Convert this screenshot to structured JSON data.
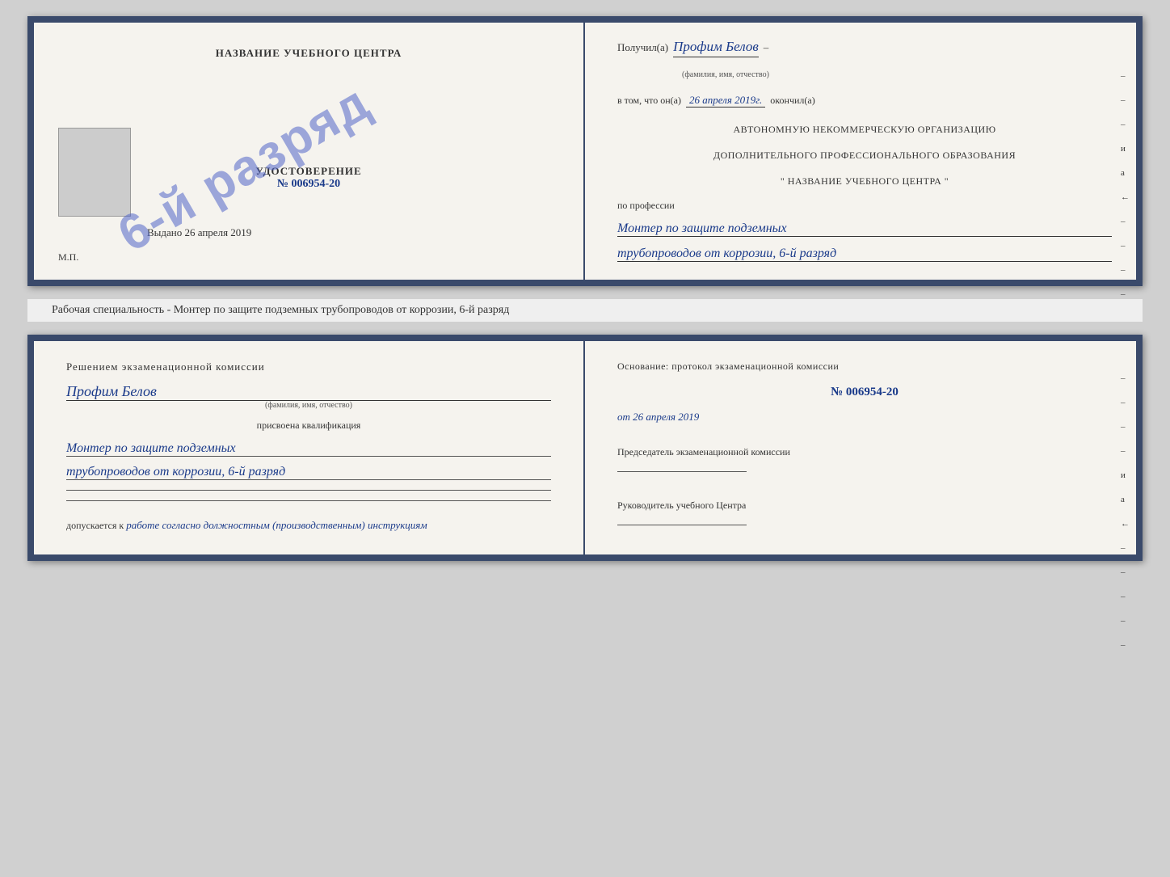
{
  "top_cert": {
    "left": {
      "title": "НАЗВАНИЕ УЧЕБНОГО ЦЕНТРА",
      "stamp_text": "6-й разряд",
      "udost_label": "УДОСТОВЕРЕНИЕ",
      "udost_number": "№ 006954-20",
      "vydano_label": "Выдано",
      "vydano_date": "26 апреля 2019",
      "mp_label": "М.П."
    },
    "right": {
      "recv_prefix": "Получил(а)",
      "recv_name": "Профим Белов",
      "recv_hint": "(фамилия, имя, отчество)",
      "vtom_prefix": "в том, что он(а)",
      "vtom_date": "26 апреля 2019г.",
      "vtom_suffix": "окончил(а)",
      "org_line1": "АВТОНОМНУЮ НЕКОММЕРЧЕСКУЮ ОРГАНИЗАЦИЮ",
      "org_line2": "ДОПОЛНИТЕЛЬНОГО ПРОФЕССИОНАЛЬНОГО ОБРАЗОВАНИЯ",
      "org_line3": "\"   НАЗВАНИЕ УЧЕБНОГО ЦЕНТРА   \"",
      "profession_label": "по профессии",
      "profession_line1": "Монтер по защите подземных",
      "profession_line2": "трубопроводов от коррозии, 6-й разряд",
      "sidebar_marks": [
        "–",
        "–",
        "–",
        "и",
        "а",
        "←",
        "–",
        "–",
        "–",
        "–"
      ]
    }
  },
  "middle_text": "Рабочая специальность - Монтер по защите подземных трубопроводов от коррозии, 6-й разряд",
  "bottom_cert": {
    "left": {
      "decision_title": "Решением экзаменационной комиссии",
      "person_name": "Профим Белов",
      "person_name_hint": "(фамилия, имя, отчество)",
      "prisvoena_text": "присвоена квалификация",
      "profession_line1": "Монтер по защите подземных",
      "profession_line2": "трубопроводов от коррозии, 6-й разряд",
      "dopusk_prefix": "допускается к",
      "dopusk_handwrite": "работе согласно должностным (производственным) инструкциям"
    },
    "right": {
      "osnov_text": "Основание: протокол экзаменационной комиссии",
      "protocol_number": "№  006954-20",
      "protocol_date_prefix": "от",
      "protocol_date": "26 апреля 2019",
      "chairman_title": "Председатель экзаменационной комиссии",
      "head_title": "Руководитель учебного Центра",
      "sidebar_marks": [
        "–",
        "–",
        "–",
        "–",
        "и",
        "а",
        "←",
        "–",
        "–",
        "–",
        "–",
        "–"
      ]
    }
  }
}
